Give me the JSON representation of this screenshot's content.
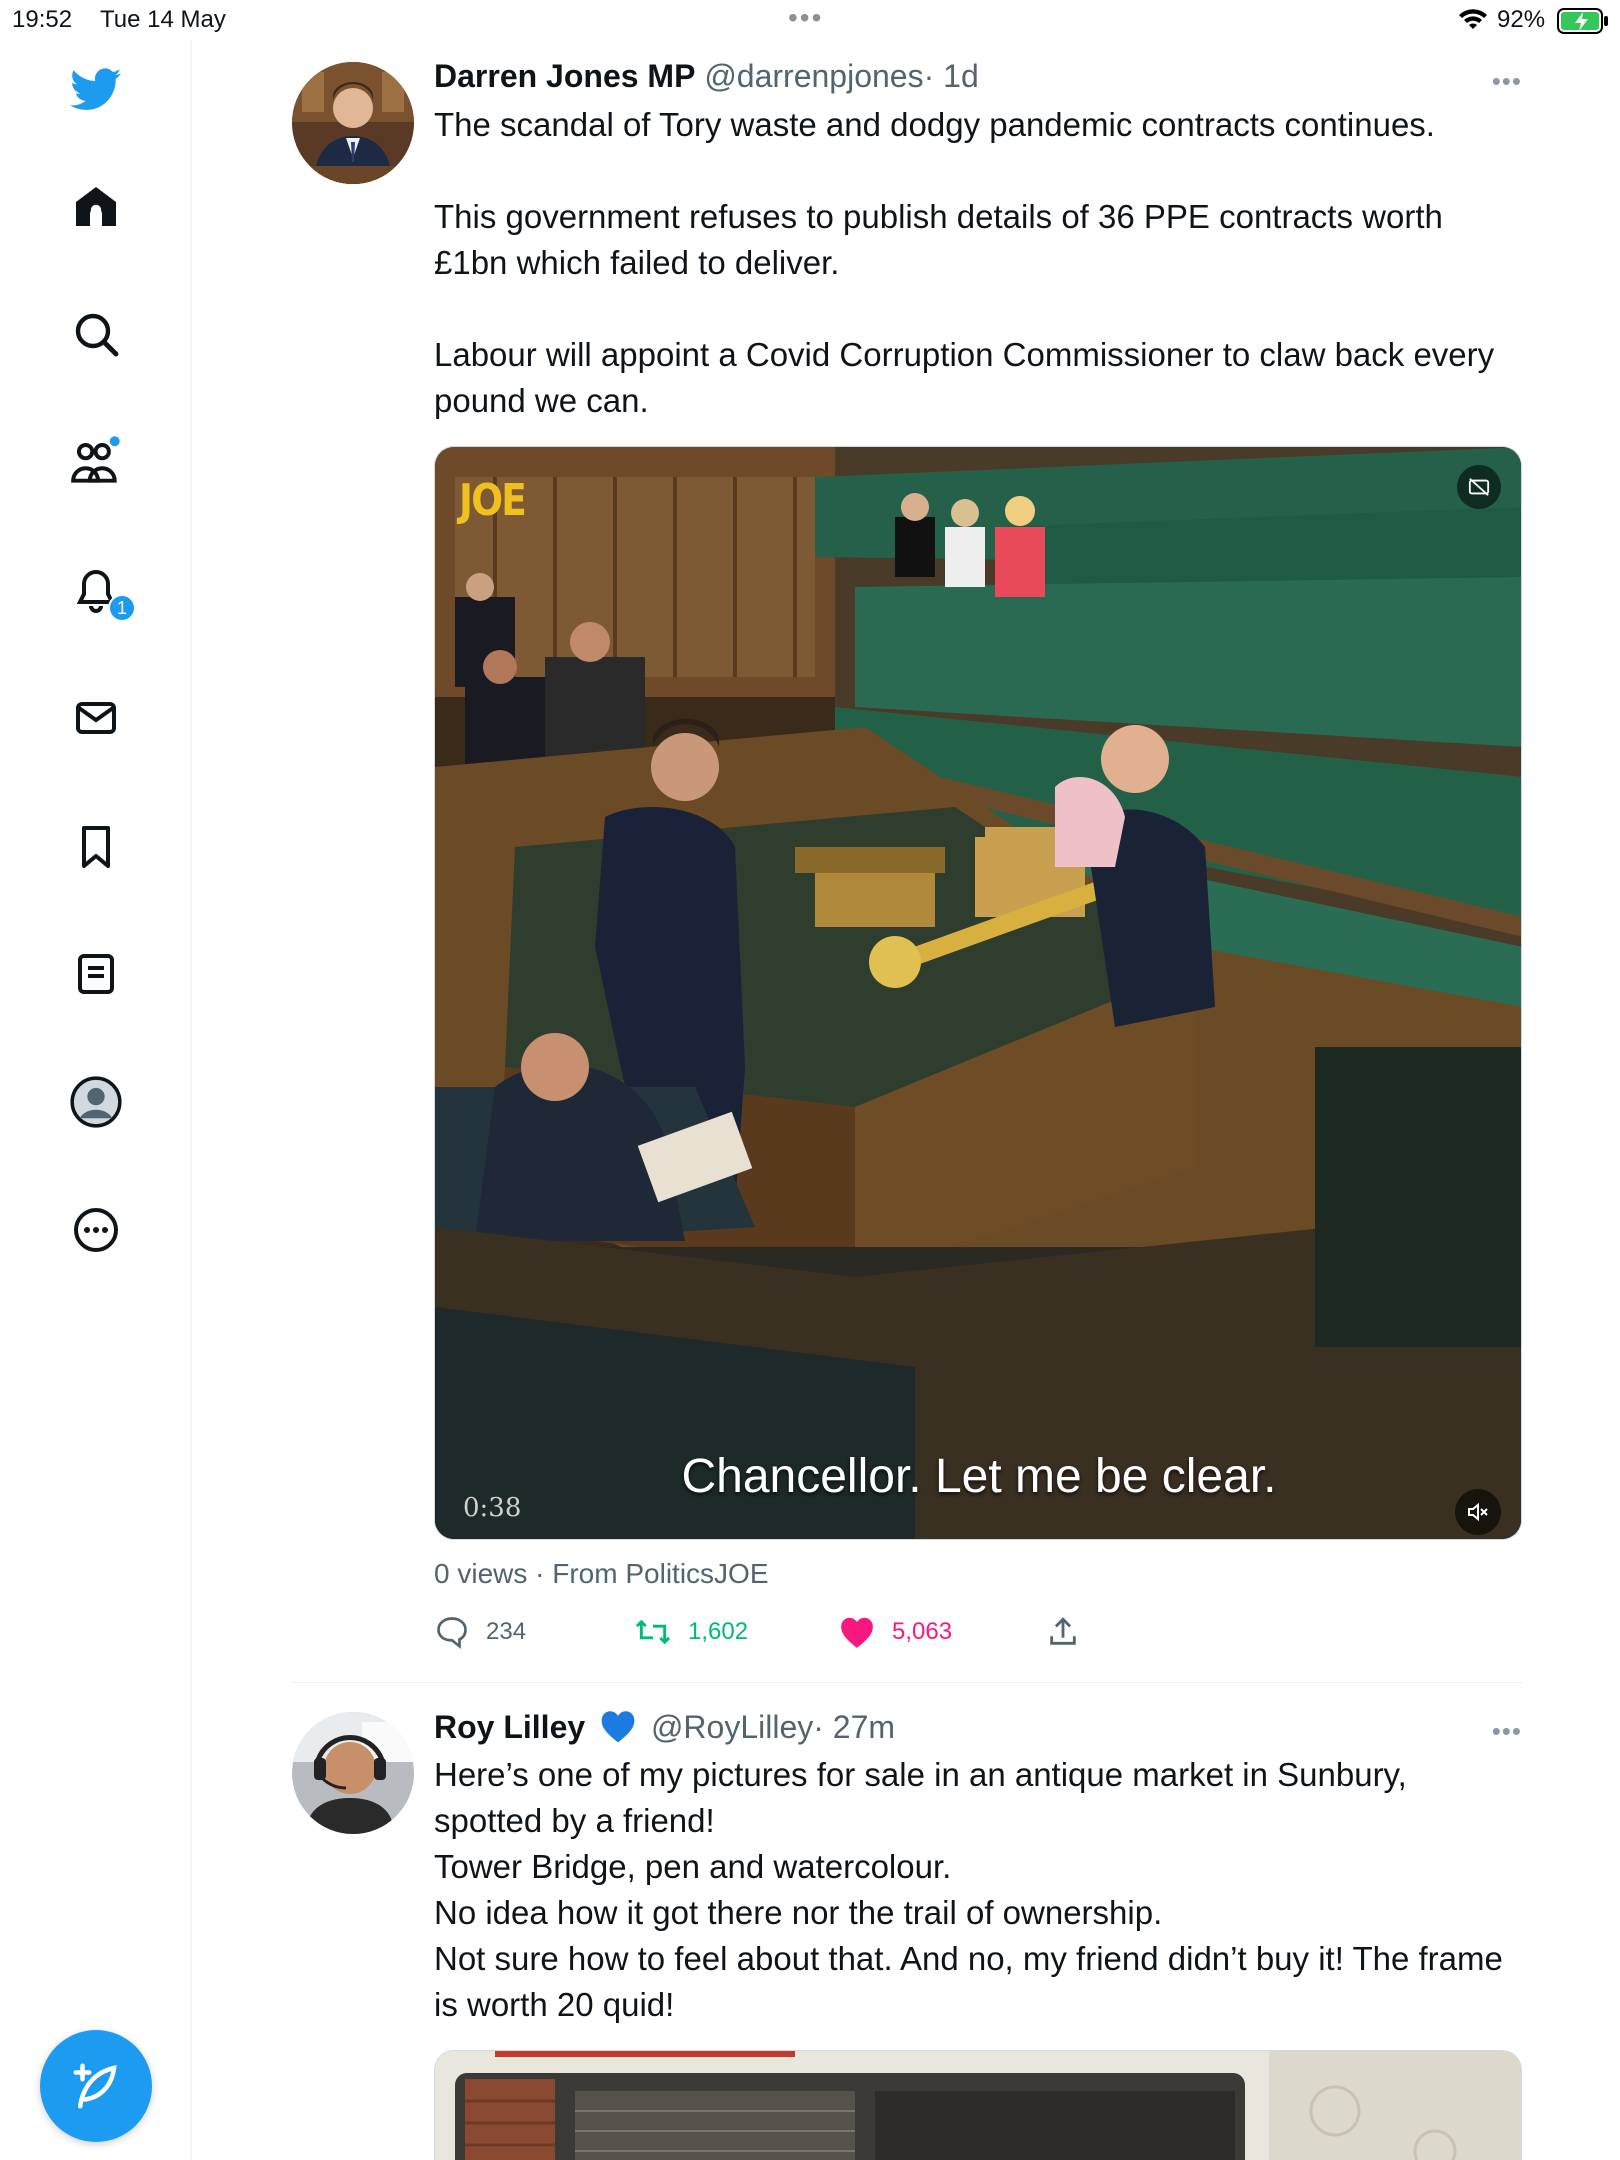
{
  "status_bar": {
    "time": "19:52",
    "date": "Tue 14 May",
    "battery": "92%"
  },
  "sidebar": {
    "notifications_badge": "1",
    "items": [
      {
        "name": "home"
      },
      {
        "name": "explore"
      },
      {
        "name": "communities"
      },
      {
        "name": "notifications"
      },
      {
        "name": "messages"
      },
      {
        "name": "bookmarks"
      },
      {
        "name": "lists"
      },
      {
        "name": "profile"
      },
      {
        "name": "more"
      }
    ]
  },
  "tweets": [
    {
      "name": "Darren Jones MP",
      "handle": "@darrenpjones",
      "time": "· 1d",
      "text": [
        "The scandal of Tory waste and dodgy pandemic contracts continues.",
        "",
        "This government refuses to publish details of 36 PPE contracts worth £1bn which failed to deliver.",
        "",
        "Labour will appoint a Covid Corruption Commissioner to claw back every pound we can."
      ],
      "video": {
        "watermark": "JOE",
        "caption": "Chancellor. Let me be clear.",
        "duration": "0:38"
      },
      "views": "0 views · From PoliticsJOE",
      "replies": "234",
      "retweets": "1,602",
      "likes": "5,063"
    },
    {
      "name": "Roy Lilley",
      "handle": "@RoyLilley",
      "time": "· 27m",
      "text": [
        "Here’s one of my pictures for sale in an antique market in Sunbury, spotted by a friend!",
        "Tower Bridge, pen and watercolour.",
        "No idea how it got there nor the trail of ownership.",
        "Not sure how to feel about that. And no, my friend didn’t buy it! The frame is worth 20 quid!"
      ]
    }
  ],
  "colors": {
    "accent": "#1d9bf0",
    "retweet": "#00ba7c",
    "like": "#f91880",
    "secondary_text": "#536471"
  }
}
